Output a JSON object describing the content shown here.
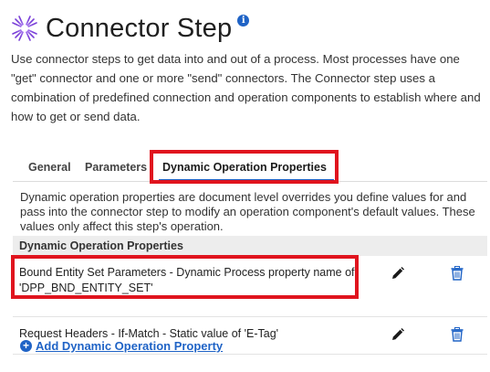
{
  "header": {
    "title": "Connector Step",
    "info_icon": "info-icon",
    "logo_icon": "starburst-logo-icon"
  },
  "intro": "Use connector steps to get data into and out of a process. Most processes have one \"get\" connector and one or more \"send\" connectors. The Connector step uses a combination of predefined connection and operation components to establish where and how to get or send data.",
  "tabs": [
    {
      "label": "General"
    },
    {
      "label": "Parameters"
    },
    {
      "label": "Dynamic Operation Properties",
      "active": true
    }
  ],
  "description": "Dynamic operation properties are document level overrides you define values for and pass into the connector step to modify an operation component's default values. These values only affect this step's operation.",
  "table": {
    "header": "Dynamic Operation Properties",
    "rows": [
      {
        "text": "Bound Entity Set Parameters - Dynamic Process property name of 'DPP_BND_ENTITY_SET'",
        "edit_icon": "pencil-icon",
        "delete_icon": "trash-icon"
      },
      {
        "text": "Request Headers - If-Match - Static value of 'E-Tag'",
        "edit_icon": "pencil-icon",
        "delete_icon": "trash-icon"
      }
    ]
  },
  "add_link": {
    "label": "Add Dynamic Operation Property",
    "icon": "plus-circle-icon"
  },
  "colors": {
    "accent": "#1f63c6",
    "highlight": "#e0141e",
    "table_header_bg": "#ededed"
  }
}
